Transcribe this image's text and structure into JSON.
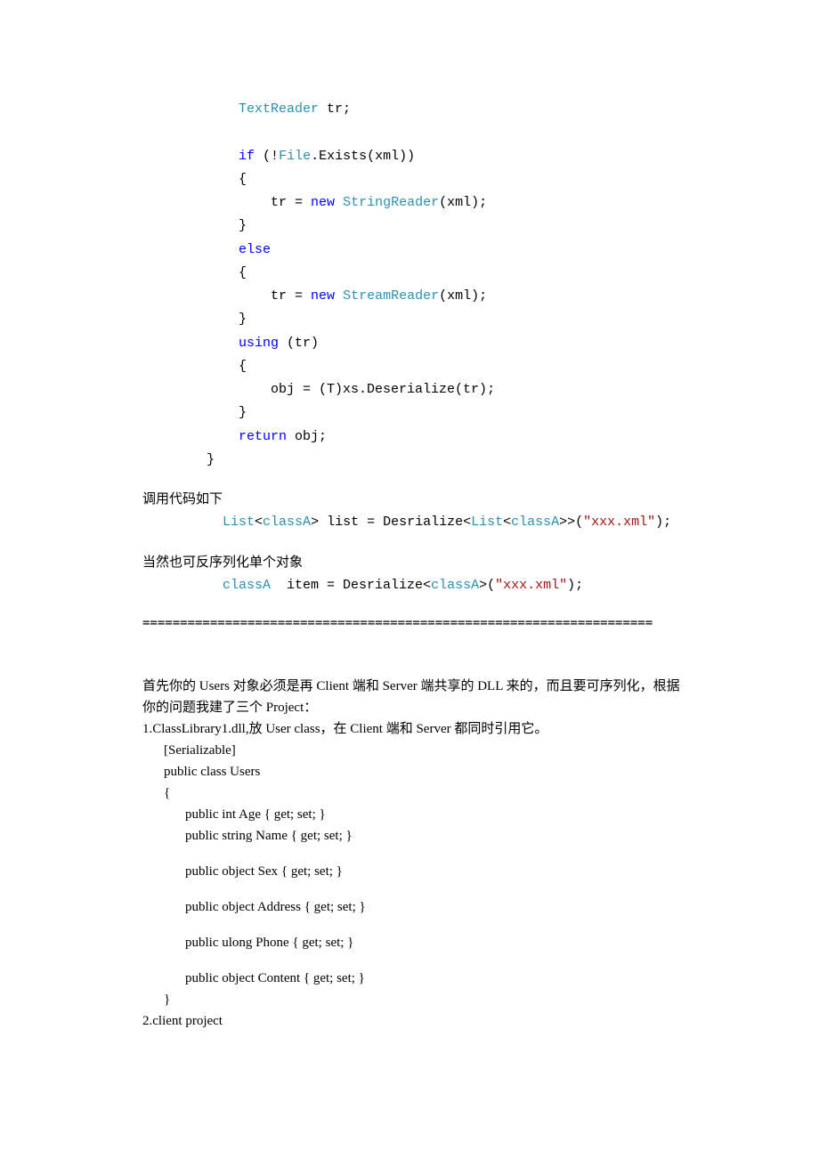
{
  "code_block": {
    "l1": {
      "a": "            ",
      "b": "TextReader",
      "c": " tr;"
    },
    "blank1": " ",
    "l2": {
      "a": "            ",
      "b": "if",
      "c": " (!",
      "d": "File",
      "e": ".Exists(xml))"
    },
    "l3": "            {",
    "l4": {
      "a": "                tr = ",
      "b": "new",
      "c": " ",
      "d": "StringReader",
      "e": "(xml);"
    },
    "l5": "            }",
    "l6": {
      "a": "            ",
      "b": "else"
    },
    "l7": "            {",
    "l8": {
      "a": "                tr = ",
      "b": "new",
      "c": " ",
      "d": "StreamReader",
      "e": "(xml);"
    },
    "l9": "            }",
    "l10": {
      "a": "            ",
      "b": "using",
      "c": " (tr)"
    },
    "l11": "            {",
    "l12": "                obj = (T)xs.Deserialize(tr);",
    "l13": "            }",
    "l14": {
      "a": "            ",
      "b": "return",
      "c": " obj;"
    },
    "l15": "        }"
  },
  "call1_label": "调用代码如下",
  "call1": {
    "a": "          ",
    "b": "List",
    "c": "<",
    "d": "classA",
    "e": "> list = Desrialize<",
    "f": "List",
    "g": "<",
    "h": "classA",
    "i": ">>(",
    "j": "\"xxx.xml\"",
    "k": ");"
  },
  "call2_label": "当然也可反序列化单个对象",
  "call2": {
    "a": "          ",
    "b": "classA",
    "c": "  item = Desrialize<",
    "d": "classA",
    "e": ">(",
    "f": "\"xxx.xml\"",
    "g": ");"
  },
  "hr": "====================================================================",
  "prose": {
    "p1": "首先你的 Users 对象必须是再 Client 端和 Server 端共享的 DLL 来的，而且要可序列化，根据你的问题我建了三个 Project：",
    "p2": "1.ClassLibrary1.dll,放 User class，在 Client 端和 Server 都同时引用它。",
    "c1": "[Serializable]",
    "c2": "public class Users",
    "c3": "{",
    "c4": "public int Age { get; set; }",
    "c5": "public string Name { get; set; }",
    "c6": "public object Sex { get; set; }",
    "c7": "public object Address { get; set; }",
    "c8": "public ulong Phone { get; set; }",
    "c9": "public object Content { get; set; }",
    "c10": "}",
    "p3": "2.client project"
  }
}
